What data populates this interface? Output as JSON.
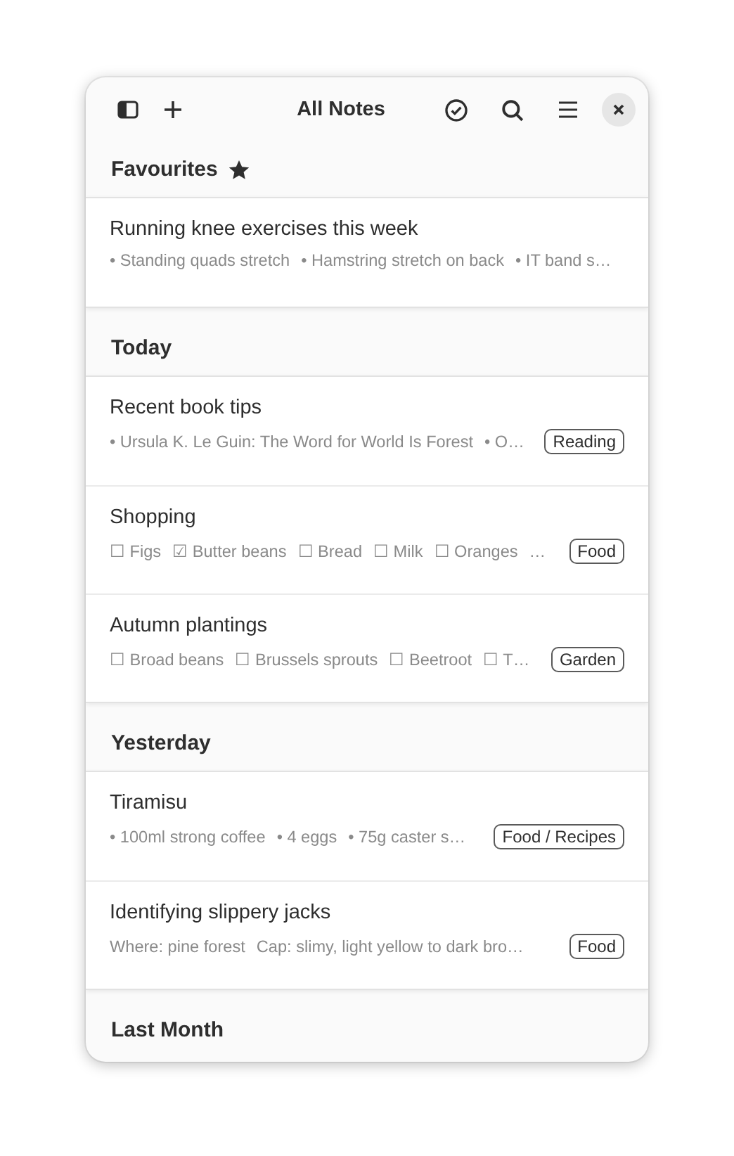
{
  "window": {
    "title": "All Notes"
  },
  "sections": [
    {
      "title": "Favourites",
      "starred": true,
      "notes": [
        {
          "title": "Running knee exercises this week",
          "preview": [
            "• Standing quads stretch",
            "• Hamstring stretch on back",
            "• IT band s…"
          ]
        }
      ]
    },
    {
      "title": "Today",
      "starred": false,
      "notes": [
        {
          "title": "Recent book tips",
          "preview": [
            "• Ursula K. Le Guin: The Word for World Is Forest",
            "• O…"
          ],
          "tag": "Reading"
        },
        {
          "title": "Shopping",
          "preview": [
            "☐ Figs",
            "☑ Butter beans",
            "☐ Bread",
            "☐ Milk",
            "☐ Oranges",
            "…"
          ],
          "tag": "Food"
        },
        {
          "title": "Autumn plantings",
          "preview": [
            "☐ Broad beans",
            "☐ Brussels sprouts",
            "☐ Beetroot",
            "☐ T…"
          ],
          "tag": "Garden"
        }
      ]
    },
    {
      "title": "Yesterday",
      "starred": false,
      "notes": [
        {
          "title": "Tiramisu",
          "preview": [
            "• 100ml strong coffee",
            "• 4 eggs",
            "• 75g caster s…"
          ],
          "tag": "Food / Recipes"
        },
        {
          "title": "Identifying slippery jacks",
          "preview": [
            "Where: pine forest",
            "Cap: slimy, light yellow to dark bro…"
          ],
          "tag": "Food"
        }
      ]
    },
    {
      "title": "Last Month",
      "starred": false
    }
  ]
}
